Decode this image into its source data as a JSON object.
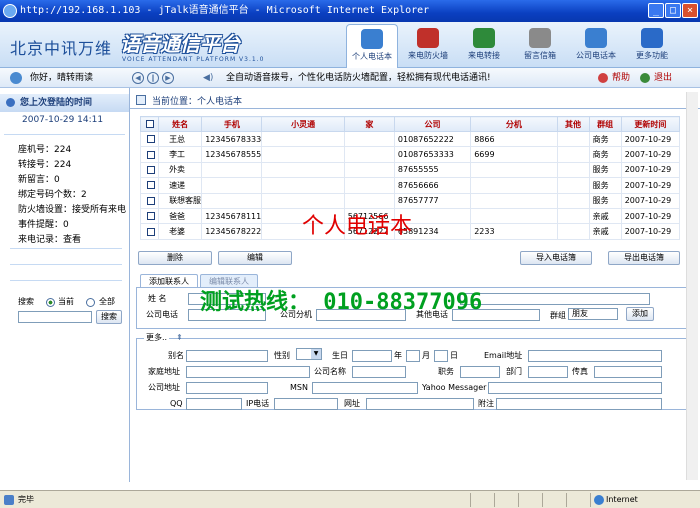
{
  "window": {
    "title": "http://192.168.1.103 - jTalk语音通信平台 - Microsoft Internet Explorer"
  },
  "banner": {
    "brand": "北京中讯万维",
    "platform": "语音通信平台",
    "platform_sub": "VOICE ATTENDANT PLATFORM V3.1.0",
    "nav": [
      {
        "label": "个人电话本",
        "icon": "phonebook-icon",
        "color": "#3a7fd0"
      },
      {
        "label": "来电防火墙",
        "icon": "firewall-icon",
        "color": "#c0302a"
      },
      {
        "label": "来电转接",
        "icon": "forward-icon",
        "color": "#2e8a3a"
      },
      {
        "label": "留言信箱",
        "icon": "mailbox-icon",
        "color": "#8a8a8a"
      },
      {
        "label": "公司电话本",
        "icon": "company-book-icon",
        "color": "#3a7fd0"
      },
      {
        "label": "更多功能",
        "icon": "more-icon",
        "color": "#2a6ac8"
      }
    ]
  },
  "infobar": {
    "greeting": "你好，晴转雨读",
    "marquee": "全自动语音拨号，个性化电话防火墙配置，轻松拥有现代电话通讯!",
    "help": "帮助",
    "logout": "退出"
  },
  "sidebar": {
    "last_login_title": "您上次登陆的时间",
    "last_login_time": "2007-10-29 14:11",
    "lines": [
      "座机号：224",
      "转接号：224",
      "新留言：0",
      "绑定号码个数：2",
      "防火墙设置：接受所有来电",
      "事件提醒：0",
      "来电记录：查看"
    ],
    "search_label": "搜索",
    "radio_current": "当前",
    "radio_all": "全部",
    "search_button": "搜索"
  },
  "main": {
    "location": "当前位置：个人电话本",
    "columns": [
      "姓名",
      "手机",
      "小灵通",
      "家",
      "公司",
      "分机",
      "其他",
      "群组",
      "更新时间"
    ],
    "rows": [
      [
        "王总",
        "12345678333",
        "",
        "",
        "01087652222",
        "8866",
        "",
        "商务",
        "2007-10-29"
      ],
      [
        "李工",
        "12345678555",
        "",
        "",
        "01087653333",
        "6699",
        "",
        "商务",
        "2007-10-29"
      ],
      [
        "外卖",
        "",
        "",
        "",
        "87655555",
        "",
        "",
        "服务",
        "2007-10-29"
      ],
      [
        "速递",
        "",
        "",
        "",
        "87656666",
        "",
        "",
        "服务",
        "2007-10-29"
      ],
      [
        "联想客服",
        "",
        "",
        "",
        "87657777",
        "",
        "",
        "服务",
        "2007-10-29"
      ],
      [
        "爸爸",
        "12345678111",
        "",
        "56712566",
        "",
        "",
        "",
        "亲戚",
        "2007-10-29"
      ],
      [
        "老婆",
        "12345678222",
        "",
        "56712222",
        "65891234",
        "2233",
        "",
        "亲戚",
        "2007-10-29"
      ]
    ],
    "buttons": {
      "delete": "删除",
      "edit": "编辑",
      "import": "导入电话簿",
      "export": "导出电话簿"
    },
    "tabs": [
      "添加联系人",
      "编辑联系人"
    ],
    "form": {
      "name": "姓 名",
      "company_phone": "公司电话",
      "company_ext": "公司分机",
      "other_phone": "其他电话",
      "group": "群组",
      "group_value": "朋友",
      "add": "添加",
      "more": "更多..",
      "alias": "别名",
      "gender": "性别",
      "birthday": "生日",
      "year": "年",
      "month": "月",
      "day": "日",
      "email": "Email地址",
      "home_addr": "家庭地址",
      "company_name": "公司名称",
      "title": "职务",
      "dept": "部门",
      "fax": "传真",
      "company_addr": "公司地址",
      "msn": "MSN",
      "yahoo": "Yahoo Messager",
      "qq": "QQ",
      "ip_phone": "IP电话",
      "website": "网址",
      "notes": "附注"
    }
  },
  "overlay": {
    "title": "个人电话本",
    "hotline": "测试热线：  010-88377096"
  },
  "status": {
    "left": "完毕",
    "zone": "Internet"
  }
}
